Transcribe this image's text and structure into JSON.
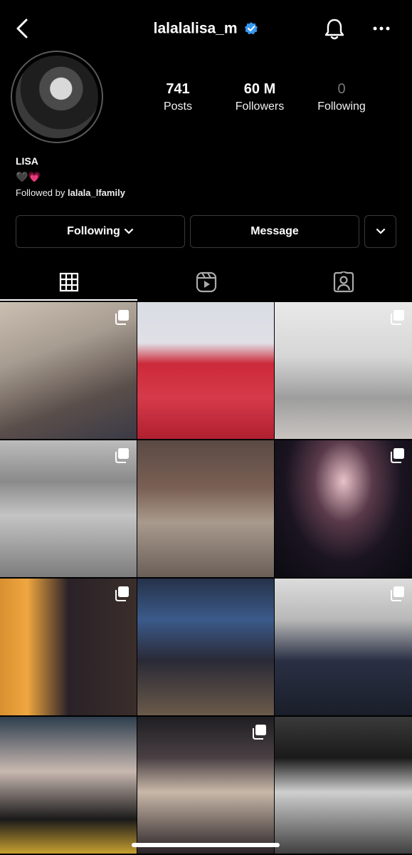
{
  "header": {
    "username": "lalalalisa_m",
    "verified": true,
    "accent_color": "#3897f0"
  },
  "stats": {
    "posts": {
      "value": "741",
      "label": "Posts"
    },
    "followers": {
      "value": "60 M",
      "label": "Followers"
    },
    "following": {
      "value": "0",
      "label": "Following"
    }
  },
  "bio": {
    "name": "LISA",
    "emoji_black": "🖤",
    "emoji_pink": "💗",
    "followed_by_prefix": "Followed by ",
    "followed_by_user": "lalala_lfamily"
  },
  "actions": {
    "following_label": "Following",
    "message_label": "Message"
  },
  "tabs": [
    {
      "icon": "grid-icon",
      "active": true
    },
    {
      "icon": "reels-icon",
      "active": false
    },
    {
      "icon": "tagged-icon",
      "active": false
    }
  ],
  "posts": [
    {
      "multi": true
    },
    {
      "multi": false
    },
    {
      "multi": true
    },
    {
      "multi": true
    },
    {
      "multi": false
    },
    {
      "multi": true
    },
    {
      "multi": true
    },
    {
      "multi": false
    },
    {
      "multi": true
    },
    {
      "multi": false
    },
    {
      "multi": true
    },
    {
      "multi": false
    }
  ]
}
